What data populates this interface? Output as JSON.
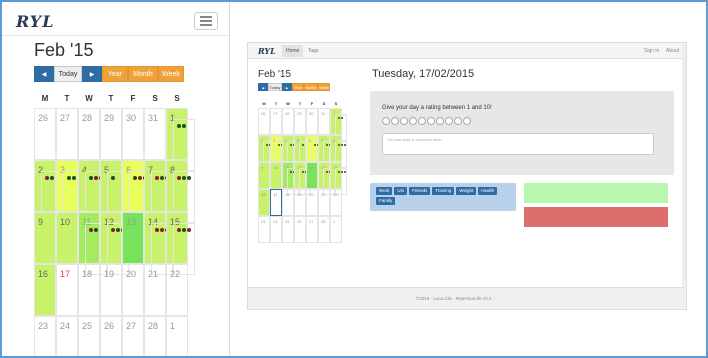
{
  "mobile": {
    "logo": "RYL",
    "month_title": "Feb '15",
    "buttons": {
      "prev": "◀",
      "today": "Today",
      "next": "▶",
      "year": "Year",
      "month": "Month",
      "week": "Week"
    },
    "days_of_week": [
      "M",
      "T",
      "W",
      "T",
      "F",
      "S",
      "S"
    ],
    "weeks": [
      [
        {
          "d": "26",
          "c": ""
        },
        {
          "d": "27",
          "c": ""
        },
        {
          "d": "28",
          "c": ""
        },
        {
          "d": "29",
          "c": ""
        },
        {
          "d": "30",
          "c": ""
        },
        {
          "d": "31",
          "c": ""
        },
        {
          "d": "1",
          "c": "lg",
          "dots": [
            "dg",
            "dg"
          ]
        }
      ],
      [
        {
          "d": "2",
          "c": "lg",
          "dots": [
            "dr",
            "dg"
          ]
        },
        {
          "d": "3",
          "c": "yl",
          "dots": [
            "dg",
            "dg"
          ]
        },
        {
          "d": "4",
          "c": "lg",
          "dots": [
            "dg",
            "dr",
            "dg"
          ]
        },
        {
          "d": "5",
          "c": "lg",
          "dots": [
            "dg"
          ]
        },
        {
          "d": "6",
          "c": "yl",
          "dots": [
            "dg",
            "dr",
            "dg"
          ]
        },
        {
          "d": "7",
          "c": "lg",
          "dots": [
            "dr",
            "dg",
            "dr"
          ]
        },
        {
          "d": "8",
          "c": "lg",
          "dots": [
            "dr",
            "dg",
            "dg"
          ]
        }
      ],
      [
        {
          "d": "9",
          "c": "lg"
        },
        {
          "d": "10",
          "c": "lg"
        },
        {
          "d": "11",
          "c": "md",
          "dots": [
            "dr",
            "dg"
          ]
        },
        {
          "d": "12",
          "c": "lg",
          "dots": [
            "dr",
            "dg",
            "dr"
          ]
        },
        {
          "d": "13",
          "c": "gn"
        },
        {
          "d": "14",
          "c": "lg",
          "dots": [
            "dr",
            "dr",
            "dg"
          ]
        },
        {
          "d": "15",
          "c": "lg",
          "dots": [
            "dr",
            "dg",
            "dr"
          ]
        }
      ],
      [
        {
          "d": "16",
          "c": "lg"
        },
        {
          "d": "17",
          "c": "",
          "red": true
        },
        {
          "d": "18",
          "c": ""
        },
        {
          "d": "19",
          "c": ""
        },
        {
          "d": "20",
          "c": ""
        },
        {
          "d": "21",
          "c": ""
        },
        {
          "d": "22",
          "c": ""
        }
      ],
      [
        {
          "d": "23",
          "c": ""
        },
        {
          "d": "24",
          "c": ""
        },
        {
          "d": "25",
          "c": ""
        },
        {
          "d": "26",
          "c": ""
        },
        {
          "d": "27",
          "c": ""
        },
        {
          "d": "28",
          "c": ""
        },
        {
          "d": "1",
          "c": ""
        }
      ]
    ]
  },
  "desktop": {
    "logo": "RYL",
    "nav": {
      "home": "Home",
      "tags": "Tags",
      "signin": "Sign in",
      "about": "About"
    },
    "month_title": "Feb '15",
    "buttons": {
      "prev": "◀",
      "today": "Today",
      "next": "▶",
      "year": "Year",
      "month": "Month",
      "week": "Week"
    },
    "days_of_week": [
      "M",
      "T",
      "W",
      "T",
      "F",
      "S",
      "S"
    ],
    "weeks": [
      [
        {
          "d": "26",
          "c": ""
        },
        {
          "d": "27",
          "c": ""
        },
        {
          "d": "28",
          "c": ""
        },
        {
          "d": "29",
          "c": ""
        },
        {
          "d": "30",
          "c": ""
        },
        {
          "d": "31",
          "c": ""
        },
        {
          "d": "1",
          "c": "lg",
          "dots": [
            "dg",
            "dg"
          ]
        }
      ],
      [
        {
          "d": "2",
          "c": "lg",
          "dots": [
            "dr",
            "dg"
          ]
        },
        {
          "d": "3",
          "c": "yl",
          "dots": [
            "dg",
            "dg"
          ]
        },
        {
          "d": "4",
          "c": "lg",
          "dots": [
            "dg",
            "dr",
            "dg"
          ]
        },
        {
          "d": "5",
          "c": "lg",
          "dots": [
            "dg"
          ]
        },
        {
          "d": "6",
          "c": "yl",
          "dots": [
            "dg",
            "dr",
            "dg"
          ]
        },
        {
          "d": "7",
          "c": "lg",
          "dots": [
            "dr",
            "dg",
            "dr"
          ]
        },
        {
          "d": "8",
          "c": "lg",
          "dots": [
            "dr",
            "dg",
            "dg"
          ]
        }
      ],
      [
        {
          "d": "9",
          "c": "lg"
        },
        {
          "d": "10",
          "c": "lg"
        },
        {
          "d": "11",
          "c": "md",
          "dots": [
            "dr",
            "dg"
          ]
        },
        {
          "d": "12",
          "c": "lg",
          "dots": [
            "dr",
            "dg",
            "dr"
          ]
        },
        {
          "d": "13",
          "c": "gn"
        },
        {
          "d": "14",
          "c": "lg",
          "dots": [
            "dr",
            "dr",
            "dg"
          ]
        },
        {
          "d": "15",
          "c": "lg",
          "dots": [
            "dr",
            "dg",
            "dr"
          ]
        }
      ],
      [
        {
          "d": "16",
          "c": "lg"
        },
        {
          "d": "17",
          "c": "sel",
          "red": true
        },
        {
          "d": "18",
          "c": ""
        },
        {
          "d": "19",
          "c": ""
        },
        {
          "d": "20",
          "c": ""
        },
        {
          "d": "21",
          "c": ""
        },
        {
          "d": "22",
          "c": ""
        }
      ],
      [
        {
          "d": "23",
          "c": ""
        },
        {
          "d": "24",
          "c": ""
        },
        {
          "d": "25",
          "c": ""
        },
        {
          "d": "26",
          "c": ""
        },
        {
          "d": "27",
          "c": ""
        },
        {
          "d": "28",
          "c": ""
        },
        {
          "d": "1",
          "c": ""
        }
      ]
    ],
    "selected_date": "Tuesday, 17/02/2015",
    "rating_prompt": "Give your day a rating between 1 and 10!",
    "star_count": 10,
    "comment_placeholder": "You can write a comment here!",
    "tags": [
      "Work",
      "Uni",
      "Friends",
      "Training",
      "Weight",
      "Health",
      "Family"
    ],
    "footer": "©2015  ·  Luca Clis  ·  RateYourLife v0.2"
  },
  "colors": {
    "accent_blue": "#2e6da4",
    "orange": "#f0a23a",
    "green_light": "#c7f26a",
    "positive": "#b8f7ad",
    "negative": "#dd6e6e"
  }
}
